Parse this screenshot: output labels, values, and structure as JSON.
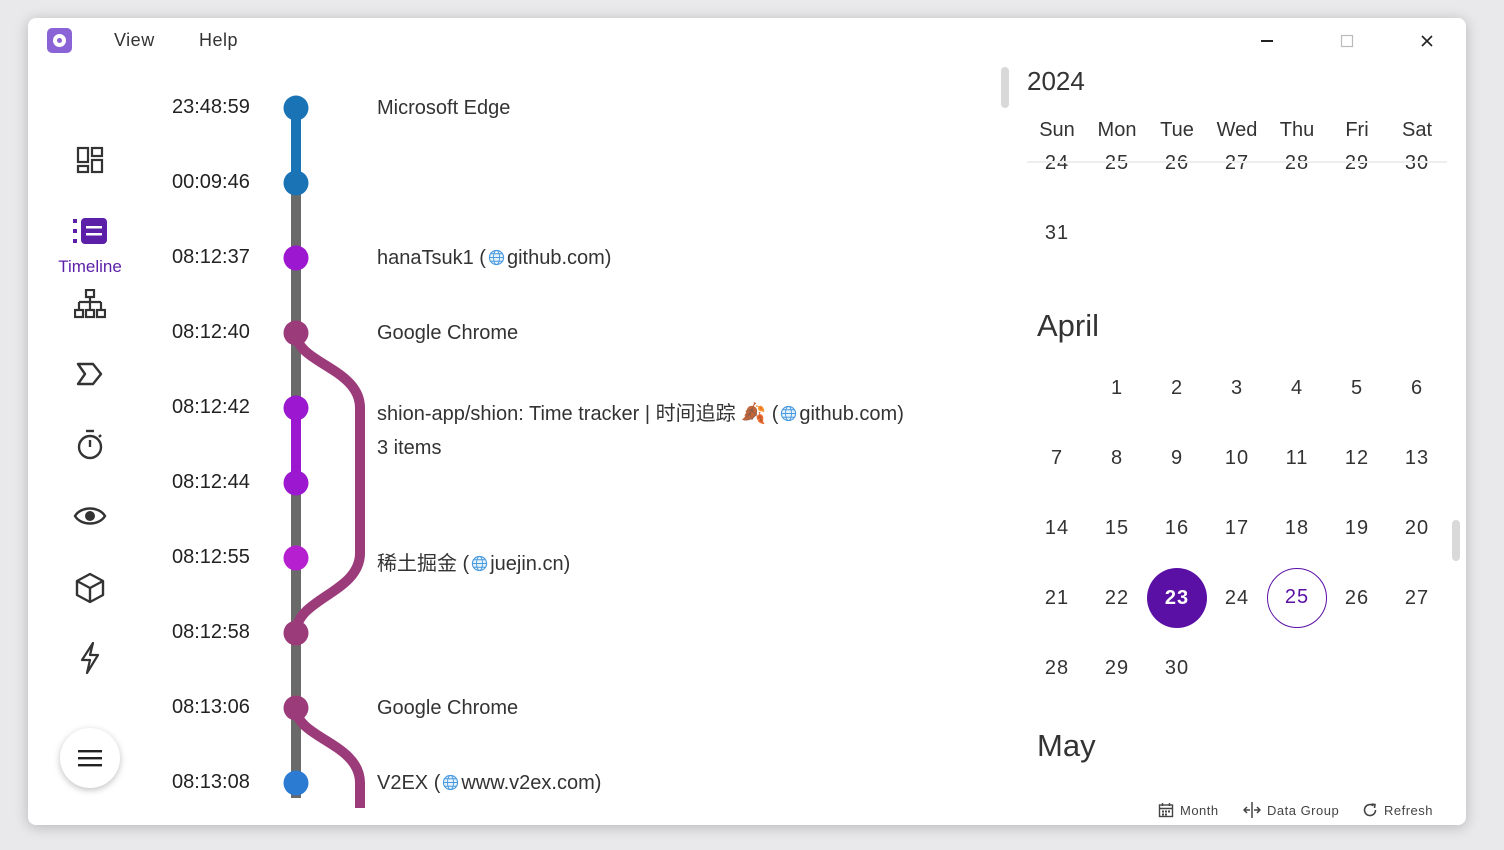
{
  "menu": {
    "view": "View",
    "help": "Help"
  },
  "rail": {
    "active_label": "Timeline"
  },
  "timeline": {
    "times": [
      "23:48:59",
      "00:09:46",
      "08:12:37",
      "08:12:40",
      "08:12:42",
      "08:12:44",
      "08:12:55",
      "08:12:58",
      "08:13:06",
      "08:13:08"
    ],
    "events": {
      "e1": "Microsoft Edge",
      "e2_name": "hanaTsuk1 (",
      "e2_site": "github.com)",
      "e3": "Google Chrome",
      "e4_name": "shion-app/shion: Time tracker | 时间追踪",
      "e4_emoji": "🍂",
      "e4_open": "(",
      "e4_site": "github.com)",
      "e4_count": "3 items",
      "e5_name": "稀土掘金 (",
      "e5_site": "juejin.cn)",
      "e6": "Google Chrome",
      "e7_name": "V2EX (",
      "e7_site": "www.v2ex.com)"
    },
    "colors": {
      "edge": "#1a73b5",
      "purple": "#9c17d0",
      "chrome": "#9b3b7a",
      "v2ex": "#2c7bd2",
      "line": "#6a6a6a"
    }
  },
  "calendar": {
    "year": "2024",
    "weekdays": [
      "Sun",
      "Mon",
      "Tue",
      "Wed",
      "Thu",
      "Fri",
      "Sat"
    ],
    "march_partial": [
      "24",
      "25",
      "26",
      "27",
      "28",
      "29",
      "30"
    ],
    "march_last": "31",
    "april": {
      "title": "April",
      "row1": [
        "1",
        "2",
        "3",
        "4",
        "5",
        "6"
      ],
      "row2": [
        "7",
        "8",
        "9",
        "10",
        "11",
        "12",
        "13"
      ],
      "row3": [
        "14",
        "15",
        "16",
        "17",
        "18",
        "19",
        "20"
      ],
      "row4": [
        "21",
        "22",
        "23",
        "24",
        "25",
        "26",
        "27"
      ],
      "row5": [
        "28",
        "29",
        "30"
      ],
      "selected_day": "23",
      "today": "25"
    },
    "may": {
      "title": "May"
    },
    "accent": "#5a0fa5"
  },
  "bottom_bar": {
    "month": "Month",
    "data_group": "Data Group",
    "refresh": "Refresh"
  }
}
